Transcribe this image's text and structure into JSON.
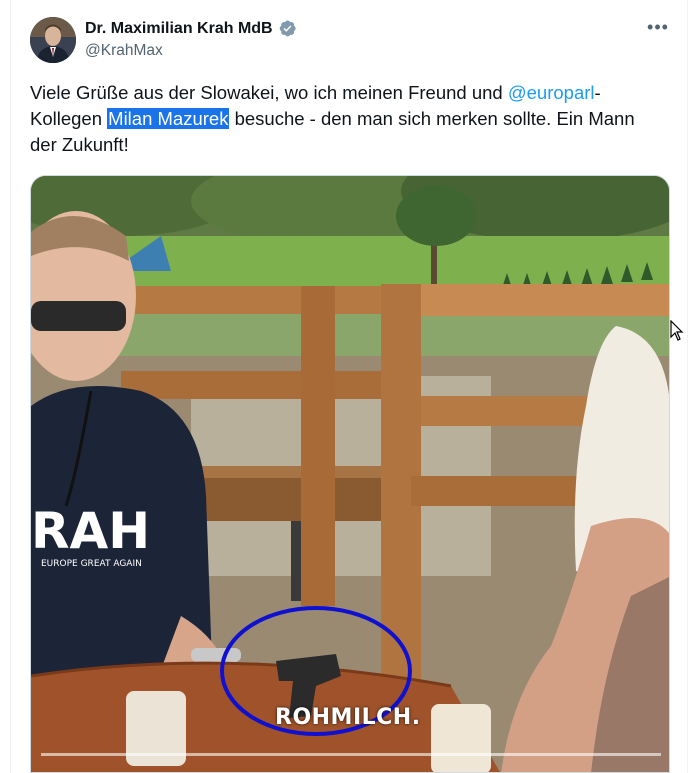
{
  "author": {
    "display_name": "Dr. Maximilian Krah MdB",
    "handle": "@KrahMax",
    "verified": true
  },
  "menu": {
    "icon": "more-dots-icon",
    "label": "•••"
  },
  "tweet": {
    "part1": "Viele Grüße aus der Slowakei, wo ich meinen Freund und ",
    "mention": "@europarl",
    "part2": "-Kollegen ",
    "highlight": "Milan Mazurek",
    "part3": " besuche - den man sich merken sollte. Ein Mann der Zukunft!"
  },
  "video": {
    "caption": "ROHMILCH.",
    "shirt_text": "RAH",
    "shirt_subtext": "EUROPE GREAT AGAIN",
    "annotation_color": "#1010d0"
  },
  "colors": {
    "link": "#1d9bf0",
    "highlight": "#1a73e8",
    "verified": "#829aab"
  }
}
